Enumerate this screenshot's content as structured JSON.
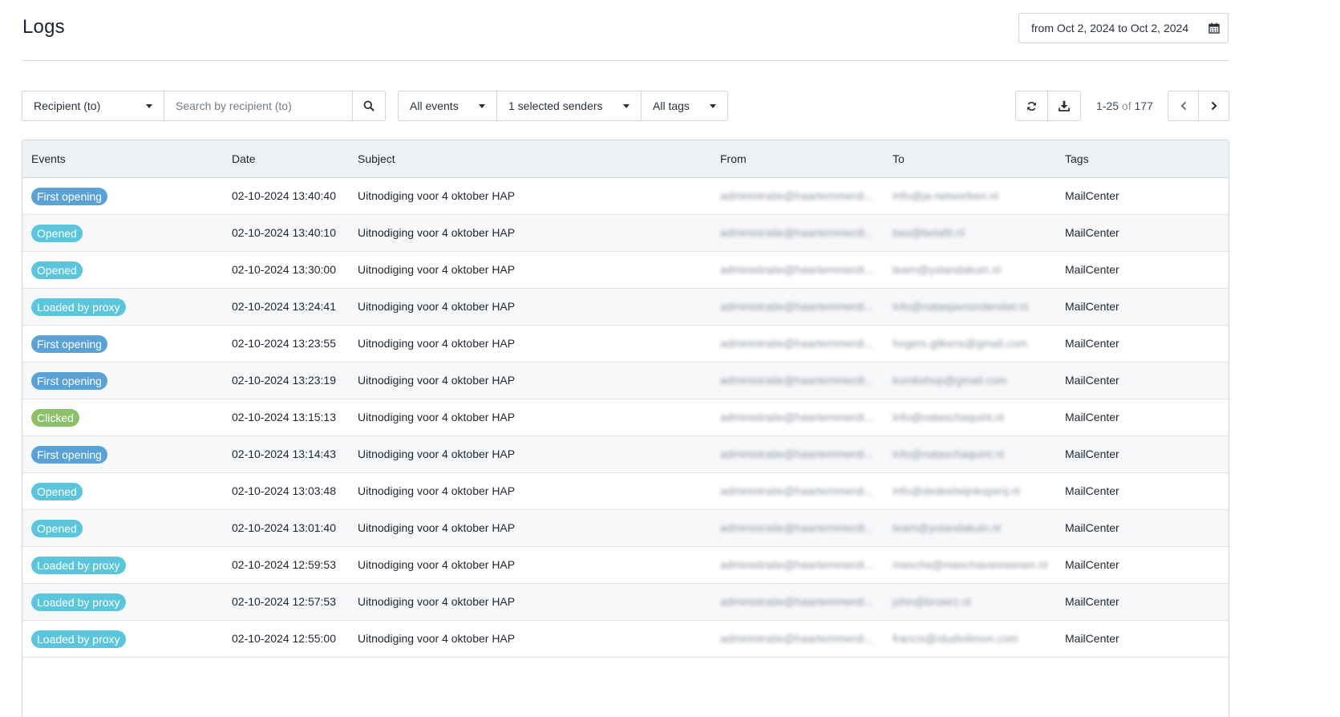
{
  "header": {
    "title": "Logs",
    "date_range": "from Oct 2, 2024 to Oct 2, 2024",
    "calendar_icon": "calendar-icon"
  },
  "filters": {
    "recipient_select": "Recipient (to)",
    "search_placeholder": "Search by recipient (to)",
    "events_select": "All events",
    "senders_select": "1 selected senders",
    "tags_select": "All tags"
  },
  "pager": {
    "range": "1-25",
    "of_label": "of",
    "total": "177"
  },
  "colors": {
    "first_opening": "#5aa2d6",
    "opened": "#5bc6db",
    "loaded_by_proxy": "#5bc6db",
    "clicked": "#8cc06a"
  },
  "table": {
    "columns": [
      "Events",
      "Date",
      "Subject",
      "From",
      "To",
      "Tags"
    ],
    "rows": [
      {
        "event": "First opening",
        "kind": "first_opening",
        "date": "02-10-2024 13:40:40",
        "subject": "Uitnodiging voor 4 oktober HAP",
        "from": "administratie@haartemmerdi...",
        "to": "info@ja-netwerken.nl",
        "tags": "MailCenter"
      },
      {
        "event": "Opened",
        "kind": "opened",
        "date": "02-10-2024 13:40:10",
        "subject": "Uitnodiging voor 4 oktober HAP",
        "from": "administratie@haartemmerdi...",
        "to": "bas@betafit.nl",
        "tags": "MailCenter"
      },
      {
        "event": "Opened",
        "kind": "opened",
        "date": "02-10-2024 13:30:00",
        "subject": "Uitnodiging voor 4 oktober HAP",
        "from": "administratie@haartemmerdi...",
        "to": "team@yolandakuin.nl",
        "tags": "MailCenter"
      },
      {
        "event": "Loaded by proxy",
        "kind": "loaded_by_proxy",
        "date": "02-10-2024 13:24:41",
        "subject": "Uitnodiging voor 4 oktober HAP",
        "from": "administratie@haartemmerdi...",
        "to": "info@natasjavoordervliet.nl",
        "tags": "MailCenter"
      },
      {
        "event": "First opening",
        "kind": "first_opening",
        "date": "02-10-2024 13:23:55",
        "subject": "Uitnodiging voor 4 oktober HAP",
        "from": "administratie@haartemmerdi...",
        "to": "hogers.gilkens@gmail.com",
        "tags": "MailCenter"
      },
      {
        "event": "First opening",
        "kind": "first_opening",
        "date": "02-10-2024 13:23:19",
        "subject": "Uitnodiging voor 4 oktober HAP",
        "from": "administratie@haartemmerdi...",
        "to": "kombshop@gmail.com",
        "tags": "MailCenter"
      },
      {
        "event": "Clicked",
        "kind": "clicked",
        "date": "02-10-2024 13:15:13",
        "subject": "Uitnodiging voor 4 oktober HAP",
        "from": "administratie@haartemmerdi...",
        "to": "info@nataschaquint.nl",
        "tags": "MailCenter"
      },
      {
        "event": "First opening",
        "kind": "first_opening",
        "date": "02-10-2024 13:14:43",
        "subject": "Uitnodiging voor 4 oktober HAP",
        "from": "administratie@haartemmerdi...",
        "to": "info@nataschaquint.nl",
        "tags": "MailCenter"
      },
      {
        "event": "Opened",
        "kind": "opened",
        "date": "02-10-2024 13:03:48",
        "subject": "Uitnodiging voor 4 oktober HAP",
        "from": "administratie@haartemmerdi...",
        "to": "info@dedeelwijnkoperij.nl",
        "tags": "MailCenter"
      },
      {
        "event": "Opened",
        "kind": "opened",
        "date": "02-10-2024 13:01:40",
        "subject": "Uitnodiging voor 4 oktober HAP",
        "from": "administratie@haartemmerdi...",
        "to": "team@yolandakuin.nl",
        "tags": "MailCenter"
      },
      {
        "event": "Loaded by proxy",
        "kind": "loaded_by_proxy",
        "date": "02-10-2024 12:59:53",
        "subject": "Uitnodiging voor 4 oktober HAP",
        "from": "administratie@haartemmerdi...",
        "to": "mascha@maschavanreenen.nl",
        "tags": "MailCenter"
      },
      {
        "event": "Loaded by proxy",
        "kind": "loaded_by_proxy",
        "date": "02-10-2024 12:57:53",
        "subject": "Uitnodiging voor 4 oktober HAP",
        "from": "administratie@haartemmerdi...",
        "to": "john@browrz.nl",
        "tags": "MailCenter"
      },
      {
        "event": "Loaded by proxy",
        "kind": "loaded_by_proxy",
        "date": "02-10-2024 12:55:00",
        "subject": "Uitnodiging voor 4 oktober HAP",
        "from": "administratie@haartemmerdi...",
        "to": "francis@studiolimon.com",
        "tags": "MailCenter"
      }
    ]
  }
}
